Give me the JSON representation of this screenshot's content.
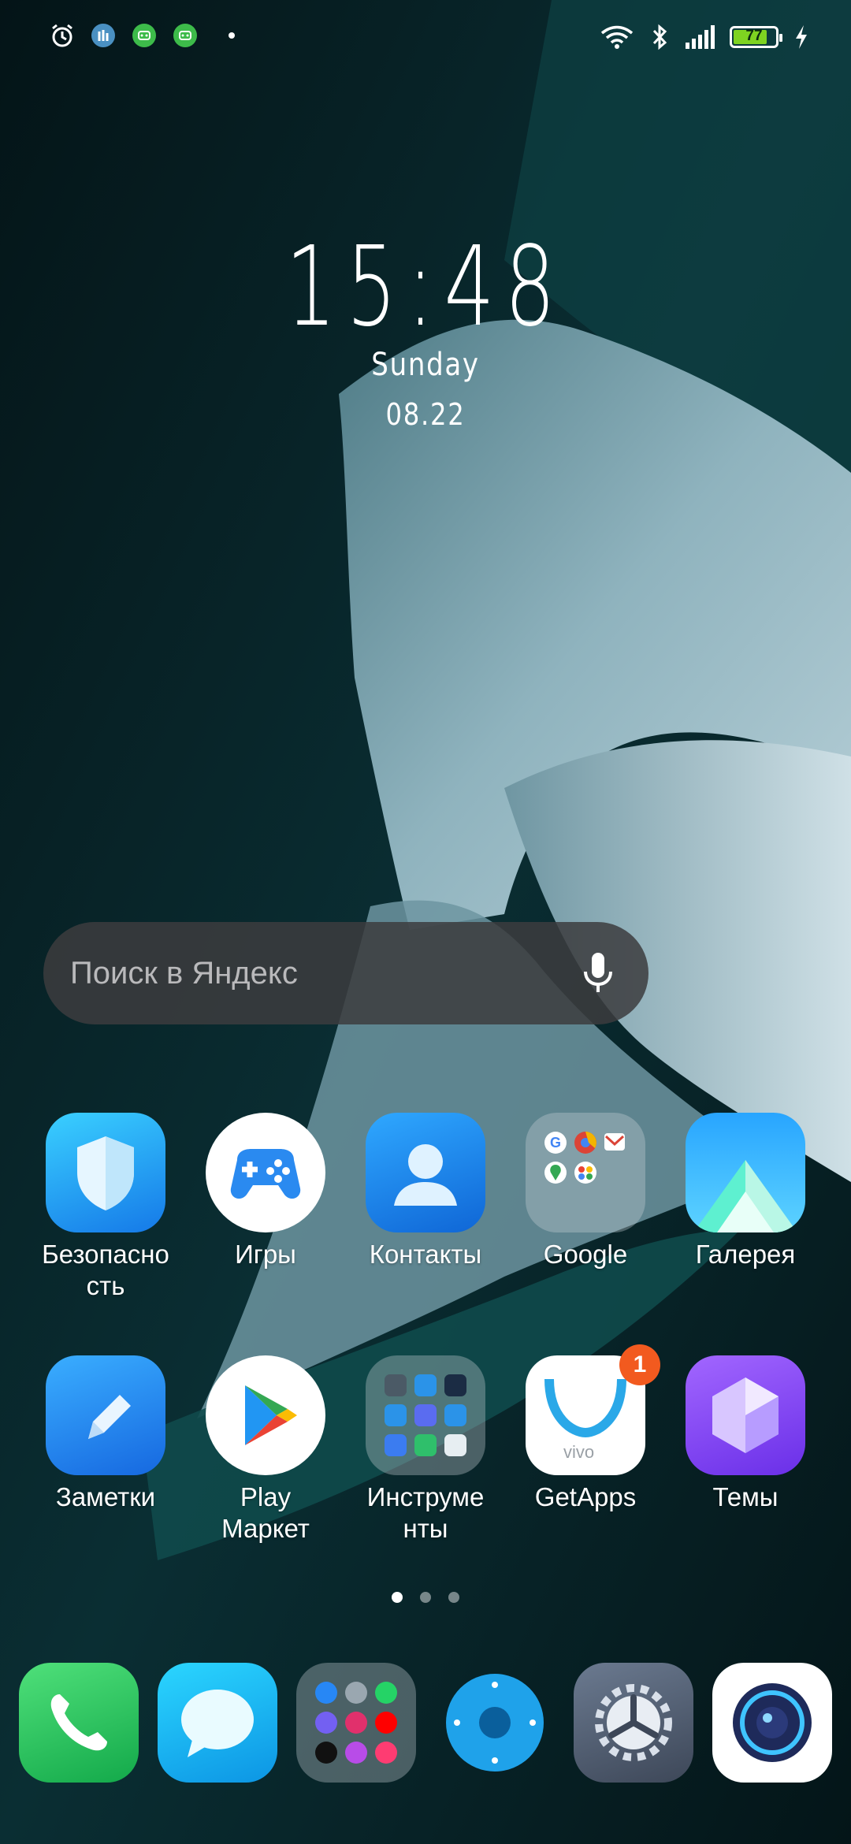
{
  "status_bar": {
    "left_icons": [
      "alarm-icon",
      "network-app-icon",
      "android-robot-icon",
      "android-robot-icon"
    ],
    "right_icons": [
      "wifi-icon",
      "bluetooth-icon",
      "signal-icon"
    ],
    "battery_level": "77",
    "charging": true
  },
  "clock": {
    "time": "15:48",
    "day": "Sunday",
    "date": "08.22"
  },
  "search": {
    "placeholder": "Поиск в Яндекс"
  },
  "apps_row1": [
    {
      "label": "Безопасно\nсть",
      "icon": "shield-icon"
    },
    {
      "label": "Игры",
      "icon": "gamepad-icon"
    },
    {
      "label": "Контакты",
      "icon": "contacts-icon"
    },
    {
      "label": "Google",
      "icon": "google-folder-icon"
    },
    {
      "label": "Галерея",
      "icon": "gallery-icon"
    }
  ],
  "apps_row2": [
    {
      "label": "Заметки",
      "icon": "notes-icon"
    },
    {
      "label": "Play\nМаркет",
      "icon": "play-store-icon"
    },
    {
      "label": "Инструме\nнты",
      "icon": "tools-folder-icon"
    },
    {
      "label": "GetApps",
      "icon": "getapps-icon",
      "badge": "1"
    },
    {
      "label": "Темы",
      "icon": "themes-icon"
    }
  ],
  "dock": [
    "phone-icon",
    "messages-icon",
    "social-folder-icon",
    "browser-icon",
    "settings-icon",
    "camera-icon"
  ],
  "pager": {
    "pages": 3,
    "active": 1
  },
  "colors": {
    "badge": "#f25a1f",
    "battery_fill": "#7ed321"
  }
}
